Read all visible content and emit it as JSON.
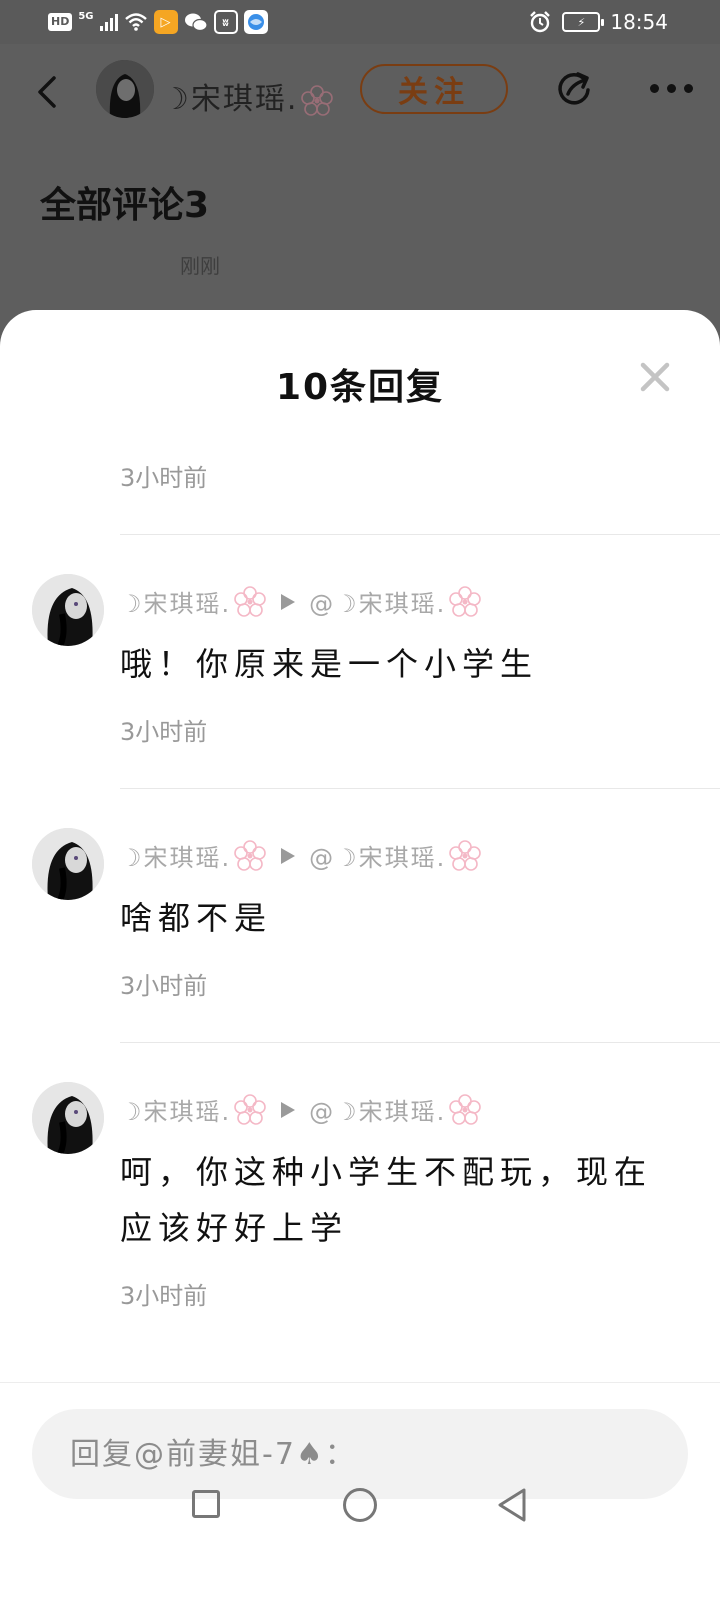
{
  "status_bar": {
    "hd": "HD",
    "network": "5G",
    "time": "18:54",
    "icons": [
      "signal-icon",
      "wifi-icon",
      "app-notification-icon",
      "wechat-icon",
      "baidu-icon",
      "browser-icon",
      "alarm-icon",
      "battery-icon"
    ]
  },
  "header": {
    "author_name": "☽宋琪瑶.",
    "follow_label": "关注",
    "all_comments_label": "全部评论3",
    "comment_time": "刚刚"
  },
  "sheet": {
    "title": "10条回复",
    "first_time": "3小时前",
    "replies": [
      {
        "author": "☽宋琪瑶.",
        "target": "@☽宋琪瑶.",
        "text": "哦！你原来是一个小学生",
        "time": "3小时前"
      },
      {
        "author": "☽宋琪瑶.",
        "target": "@☽宋琪瑶.",
        "text": "啥都不是",
        "time": "3小时前"
      },
      {
        "author": "☽宋琪瑶.",
        "target": "@☽宋琪瑶.",
        "text": "呵，你这种小学生不配玩，现在应该好好上学",
        "time": "3小时前"
      }
    ]
  },
  "input": {
    "placeholder": "回复@前妻姐-7♠："
  },
  "colors": {
    "accent_follow": "#7a3d12",
    "flower_pink": "#f4b8c6",
    "muted_text": "#999999",
    "overlay": "#5e5e5e"
  }
}
